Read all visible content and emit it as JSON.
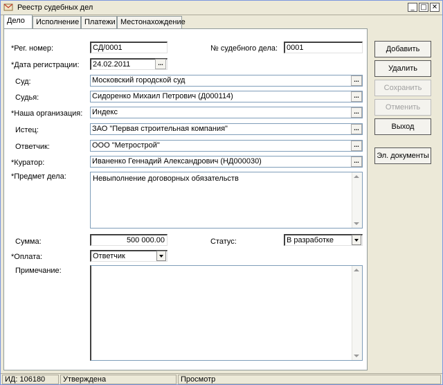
{
  "window": {
    "title": "Реестр судебных дел"
  },
  "tabs": [
    {
      "label": "Дело"
    },
    {
      "label": "Исполнение"
    },
    {
      "label": "Платежи"
    },
    {
      "label": "Местонахождение"
    }
  ],
  "form": {
    "reg_number": {
      "label": "*Рег. номер:",
      "value": "СД/0001"
    },
    "court_case_number": {
      "label": "№ судебного дела:",
      "value": "0001"
    },
    "reg_date": {
      "label": "*Дата регистрации:",
      "value": "24.02.2011"
    },
    "court": {
      "label": "Суд:",
      "value": "Московский городской суд"
    },
    "judge": {
      "label": "Судья:",
      "value": "Сидоренко Михаил Петрович (Д000114)"
    },
    "our_org": {
      "label": "*Наша организация:",
      "value": "Индекс"
    },
    "plaintiff": {
      "label": "Истец:",
      "value": "ЗАО \"Первая строительная компания\""
    },
    "defendant": {
      "label": "Ответчик:",
      "value": "ООО \"Метрострой\""
    },
    "curator": {
      "label": "*Куратор:",
      "value": "Иваненко Геннадий Александрович (НД000030)"
    },
    "subject": {
      "label": "*Предмет дела:",
      "value": "Невыполнение договорных обязательств"
    },
    "amount": {
      "label": "Сумма:",
      "value": "500 000.00"
    },
    "status": {
      "label": "Статус:",
      "value": "В разработке"
    },
    "payment": {
      "label": "*Оплата:",
      "value": "Ответчик"
    },
    "note": {
      "label": "Примечание:",
      "value": ""
    }
  },
  "buttons": {
    "add": "Добавить",
    "delete": "Удалить",
    "save": "Сохранить",
    "cancel": "Отменить",
    "exit": "Выход",
    "edocs": "Эл. документы"
  },
  "statusbar": {
    "id": "ИД: 106180",
    "state": "Утверждена",
    "mode": "Просмотр"
  },
  "dots_label": "...",
  "window_controls": {
    "minimize": "_",
    "maximize": "□",
    "close": "✕"
  }
}
